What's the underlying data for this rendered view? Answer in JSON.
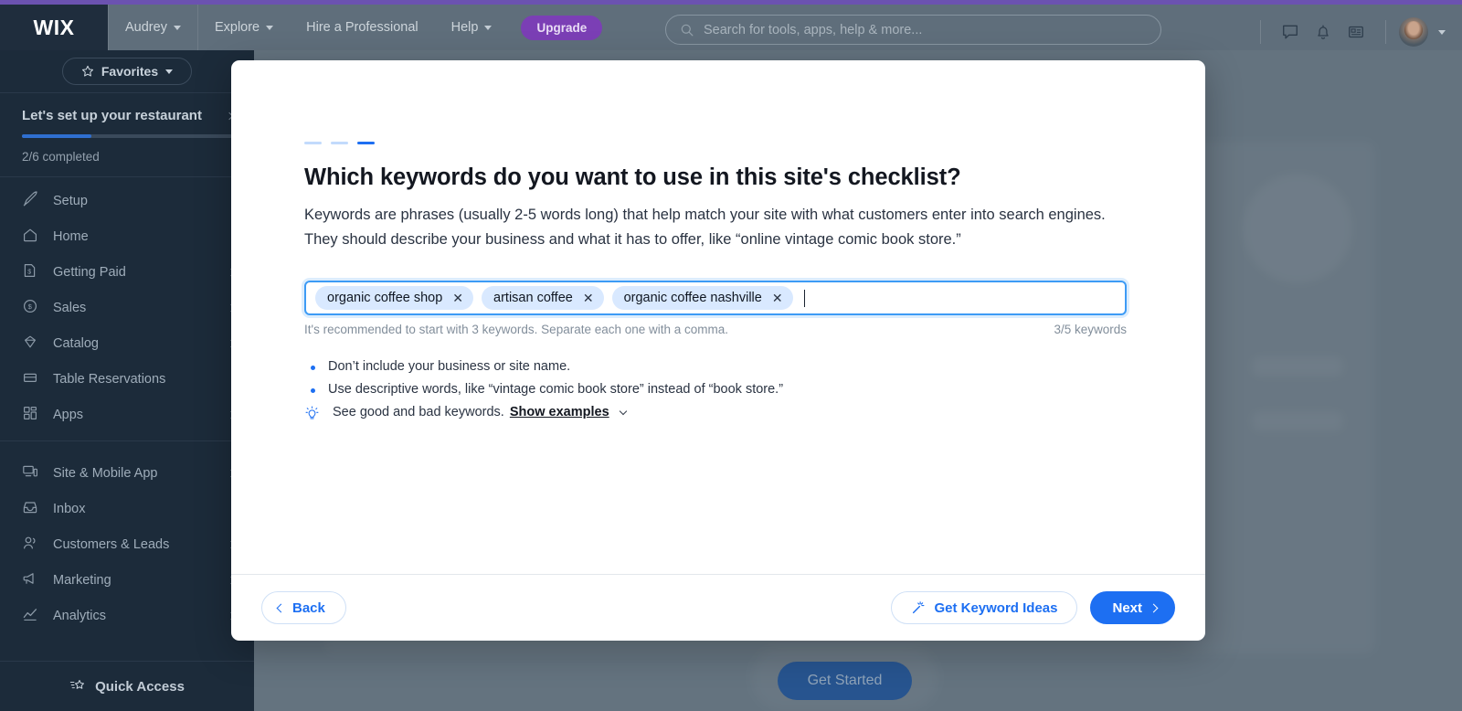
{
  "topbar": {
    "logo": "WIX",
    "nav": [
      {
        "label": "Audrey",
        "has_caret": true
      },
      {
        "label": "Explore",
        "has_caret": true
      },
      {
        "label": "Hire a Professional",
        "has_caret": false
      },
      {
        "label": "Help",
        "has_caret": true
      }
    ],
    "upgrade_label": "Upgrade",
    "search_placeholder": "Search for tools, apps, help & more...",
    "icons": [
      "chat-icon",
      "bell-icon",
      "news-icon"
    ],
    "avatar_label": "avatar"
  },
  "sidebar": {
    "favorites_label": "Favorites",
    "setup": {
      "title": "Let's set up your restaurant",
      "progress_text": "2/6 completed",
      "progress_percent": 33
    },
    "items": [
      {
        "label": "Setup",
        "icon": "rocket-icon",
        "has_chevron": false
      },
      {
        "label": "Home",
        "icon": "home-icon",
        "has_chevron": false
      },
      {
        "label": "Getting Paid",
        "icon": "invoice-icon",
        "has_chevron": true
      },
      {
        "label": "Sales",
        "icon": "dollar-circle-icon",
        "has_chevron": true
      },
      {
        "label": "Catalog",
        "icon": "catalog-icon",
        "has_chevron": true
      },
      {
        "label": "Table Reservations",
        "icon": "table-icon",
        "has_chevron": false
      },
      {
        "label": "Apps",
        "icon": "apps-icon",
        "has_chevron": true
      }
    ],
    "items2": [
      {
        "label": "Site & Mobile App",
        "icon": "devices-icon",
        "has_chevron": true
      },
      {
        "label": "Inbox",
        "icon": "inbox-icon",
        "has_chevron": false
      },
      {
        "label": "Customers & Leads",
        "icon": "people-icon",
        "has_chevron": true
      },
      {
        "label": "Marketing",
        "icon": "megaphone-icon",
        "has_chevron": true
      },
      {
        "label": "Analytics",
        "icon": "chart-icon",
        "has_chevron": true
      }
    ],
    "quick_access_label": "Quick Access"
  },
  "background": {
    "get_started_label": "Get Started"
  },
  "modal": {
    "steps": {
      "total": 3,
      "active_index": 2
    },
    "title": "Which keywords do you want to use in this site's checklist?",
    "description": "Keywords are phrases (usually 2-5 words long) that help match your site with what customers enter into search engines. They should describe your business and what it has to offer, like “online vintage comic book store.”",
    "keywords": [
      "organic coffee shop",
      "artisan coffee",
      "organic coffee nashville"
    ],
    "remove_glyph": "✕",
    "field_hint": "It's recommended to start with 3 keywords. Separate each one with a comma.",
    "field_count": "3/5 keywords",
    "tips": [
      {
        "type": "bullet",
        "text": "Don’t include your business or site name."
      },
      {
        "type": "bullet",
        "text": "Use descriptive words, like “vintage comic book store” instead of “book store.”"
      }
    ],
    "examples_row": {
      "icon": "lightbulb-icon",
      "text": "See good and bad keywords.",
      "link_label": "Show examples"
    },
    "footer": {
      "back_label": "Back",
      "ideas_label": "Get Keyword Ideas",
      "next_label": "Next"
    }
  },
  "colors": {
    "accent_blue": "#1d6ff2",
    "chip_bg": "#d9e9ff",
    "sidebar_bg": "#1c2b3a",
    "upgrade_purple": "#7b3fb5",
    "top_accent": "#6b52b0"
  }
}
